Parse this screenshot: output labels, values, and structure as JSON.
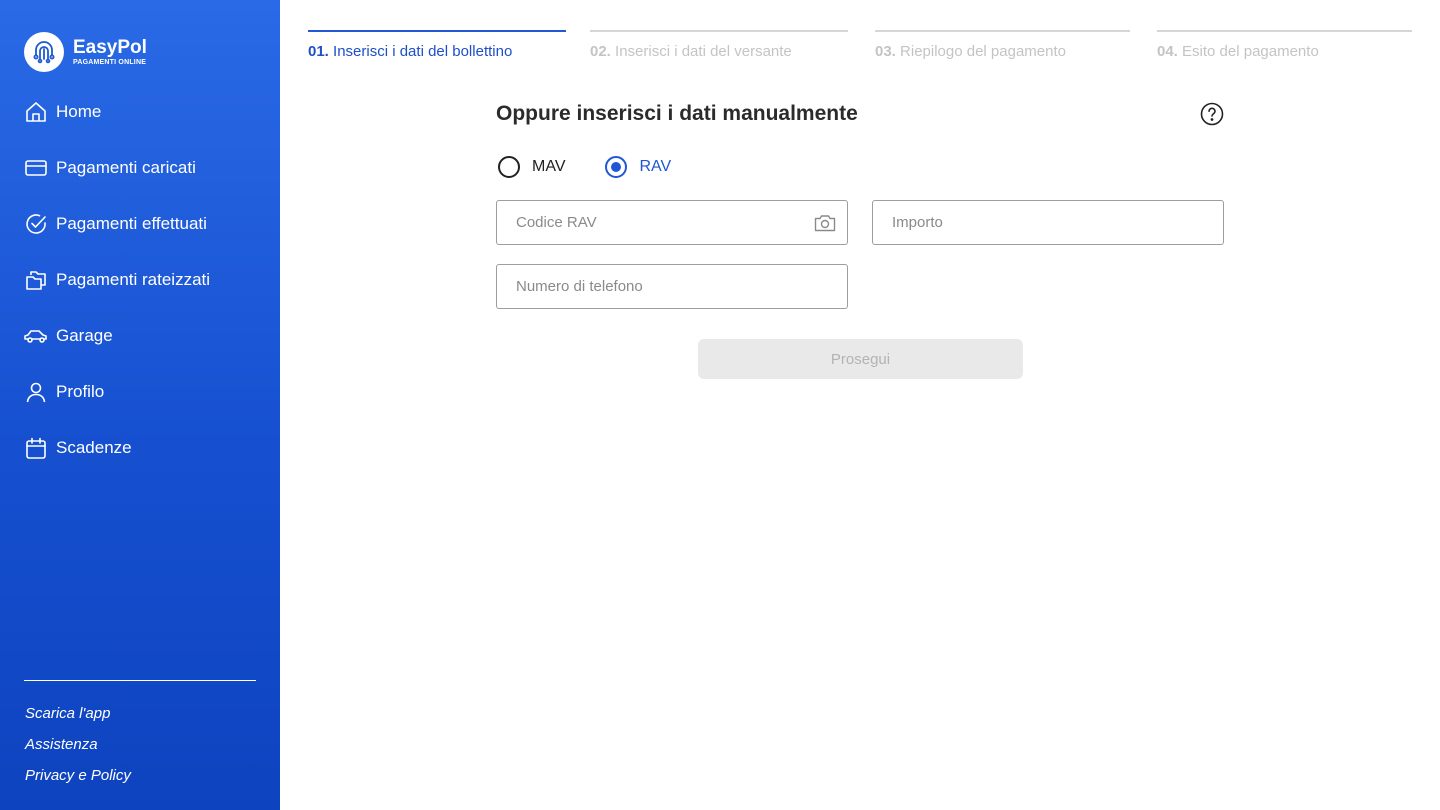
{
  "brand": {
    "name": "EasyPol",
    "tagline": "PAGAMENTI ONLINE"
  },
  "nav": [
    {
      "label": "Home",
      "icon": "home-icon"
    },
    {
      "label": "Pagamenti caricati",
      "icon": "credit-card-icon"
    },
    {
      "label": "Pagamenti effettuati",
      "icon": "check-circle-icon"
    },
    {
      "label": "Pagamenti rateizzati",
      "icon": "folders-icon"
    },
    {
      "label": "Garage",
      "icon": "car-icon"
    },
    {
      "label": "Profilo",
      "icon": "user-icon"
    },
    {
      "label": "Scadenze",
      "icon": "calendar-icon"
    }
  ],
  "footer": {
    "download": "Scarica l'app",
    "support": "Assistenza",
    "privacy": "Privacy e Policy"
  },
  "steps": [
    {
      "num": "01.",
      "label": "Inserisci i dati del bollettino",
      "active": true
    },
    {
      "num": "02.",
      "label": "Inserisci i dati del versante",
      "active": false
    },
    {
      "num": "03.",
      "label": "Riepilogo del pagamento",
      "active": false
    },
    {
      "num": "04.",
      "label": "Esito del pagamento",
      "active": false
    }
  ],
  "form": {
    "title": "Oppure inserisci i dati manualmente",
    "options": {
      "mav": "MAV",
      "rav": "RAV",
      "selected": "RAV"
    },
    "codice": {
      "placeholder": "Codice RAV",
      "value": ""
    },
    "importo": {
      "placeholder": "Importo",
      "value": ""
    },
    "telefono": {
      "placeholder": "Numero di telefono",
      "value": ""
    },
    "submit_label": "Prosegui"
  },
  "colors": {
    "primary": "#1f57d8",
    "sidebar_top": "#2a6ae6",
    "sidebar_bottom": "#0e43bf",
    "inactive": "#c4c4c4"
  }
}
